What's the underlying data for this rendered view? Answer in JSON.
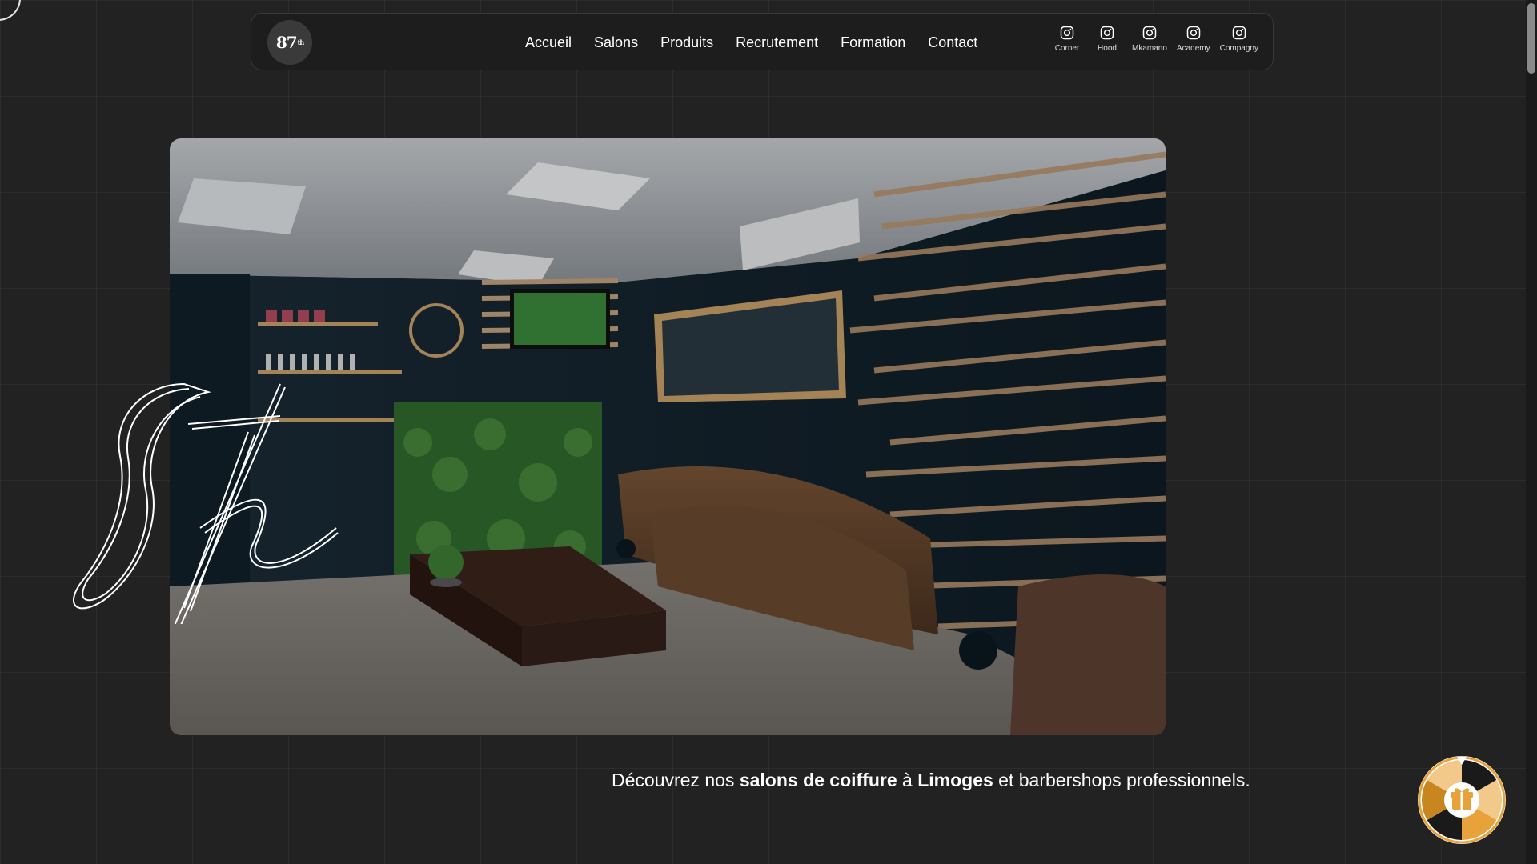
{
  "nav": {
    "logo_text": "87",
    "logo_sup": "th",
    "links": [
      "Accueil",
      "Salons",
      "Produits",
      "Recrutement",
      "Formation",
      "Contact"
    ],
    "socials": [
      {
        "icon": "instagram-icon",
        "label": "Corner"
      },
      {
        "icon": "instagram-icon",
        "label": "Hood"
      },
      {
        "icon": "instagram-icon",
        "label": "Mkamano"
      },
      {
        "icon": "instagram-icon",
        "label": "Academy"
      },
      {
        "icon": "instagram-icon",
        "label": "Compagny"
      }
    ]
  },
  "tagline": {
    "part1": "Découvrez nos ",
    "bold1": "salons de coiffure",
    "part2": " à ",
    "bold2": "Limoges",
    "part3": " et barbershops professionnels."
  },
  "signature_text": "87th",
  "colors": {
    "background": "#222222",
    "accent_gold": "#e8a23a"
  },
  "widgets": {
    "gift_icon": "gift-icon"
  }
}
